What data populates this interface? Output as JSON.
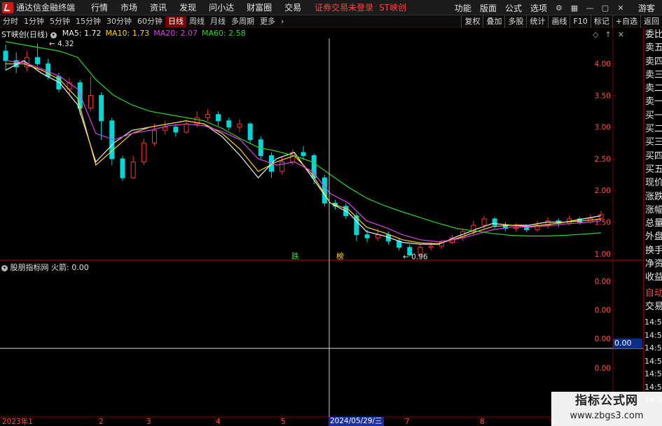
{
  "app": {
    "title": "通达信金融终端",
    "status": "证券交易未登录",
    "stock": "ST峡创"
  },
  "menu": [
    "行情",
    "市场",
    "资讯",
    "发现",
    "问小达",
    "财富圈",
    "交易"
  ],
  "right_menu": [
    "功能",
    "版面",
    "公式",
    "选项"
  ],
  "user_label": "游客",
  "periods": [
    "分时",
    "1分钟",
    "5分钟",
    "15分钟",
    "30分钟",
    "60分钟",
    "日线",
    "周线",
    "月线",
    "多周期",
    "更多"
  ],
  "active_period": "日线",
  "tools": [
    "复权",
    "叠加",
    "多股",
    "统计",
    "画线",
    "F10",
    "标记",
    "+自选",
    "返回"
  ],
  "legend": {
    "name": "ST峡创(日线)",
    "ma": [
      {
        "label": "MA5: 1.72",
        "color": "#f0f0f0"
      },
      {
        "label": "MA10: 1.73",
        "color": "#ffd21e"
      },
      {
        "label": "MA20: 2.07",
        "color": "#e040e8"
      },
      {
        "label": "MA60: 2.58",
        "color": "#27d827"
      }
    ]
  },
  "indicator": {
    "legend": "股朋指标网  火箭: 0.00",
    "value": "0.00",
    "ticks": [
      "0.00",
      "0.00",
      "0.00",
      "0.00",
      "0.00"
    ]
  },
  "side_panel": {
    "labels": [
      "委比",
      "卖五",
      "卖四",
      "卖三",
      "卖二",
      "卖一",
      "买一",
      "买二",
      "买三",
      "买四",
      "买五",
      "现价",
      "涨跌",
      "涨幅",
      "总量",
      "外盘",
      "换手",
      "净资",
      "收益"
    ],
    "lower": [
      "自动",
      "交易"
    ],
    "times": [
      "14:55",
      "14:55",
      "14:55",
      "14:56",
      "14:56",
      "14:56",
      "14:56"
    ]
  },
  "annotations": {
    "high": "4.32",
    "low": "0.96",
    "mark_down": "跌",
    "mark_flag": "榜"
  },
  "selected_date": "2024/05/29/三",
  "watermark": {
    "line1": "指标公式网",
    "line2": "www.zbgs3.com"
  },
  "colors": {
    "up": "#ff3030",
    "down": "#00d8d8",
    "ma5": "#f0f0f0",
    "ma10": "#ffd21e",
    "ma20": "#e040e8",
    "ma60": "#27d827",
    "grid": "#7a0000"
  },
  "chart_data": {
    "type": "candlestick",
    "y_ticks": [
      1.0,
      1.5,
      2.0,
      2.5,
      3.0,
      3.5,
      4.0
    ],
    "ylim": [
      0.92,
      4.4
    ],
    "x_labels": [
      "2023年1",
      "2",
      "3",
      "4",
      "5",
      "7",
      "8",
      "9"
    ],
    "ma_lines": {
      "ma5": [
        3.9,
        4.05,
        3.85,
        3.7,
        3.35,
        2.45,
        2.75,
        2.95,
        3.0,
        3.05,
        3.1,
        3.05,
        2.85,
        2.55,
        2.2,
        2.5,
        2.6,
        2.2,
        1.8,
        1.65,
        1.35,
        1.28,
        1.18,
        1.15,
        1.15,
        1.27,
        1.38,
        1.48,
        1.45,
        1.45,
        1.5,
        1.5,
        1.55,
        1.6
      ],
      "ma10": [
        4.0,
        4.0,
        3.9,
        3.75,
        3.45,
        2.4,
        2.65,
        2.9,
        3.0,
        3.05,
        3.1,
        3.05,
        2.9,
        2.65,
        2.3,
        2.45,
        2.55,
        2.25,
        1.8,
        1.7,
        1.42,
        1.33,
        1.22,
        1.17,
        1.16,
        1.24,
        1.34,
        1.43,
        1.45,
        1.43,
        1.46,
        1.5,
        1.52,
        1.55
      ],
      "ma20": [
        4.05,
        4.02,
        3.92,
        3.8,
        3.6,
        2.9,
        2.8,
        2.9,
        2.95,
        3.02,
        3.05,
        3.02,
        2.93,
        2.8,
        2.5,
        2.4,
        2.45,
        2.3,
        1.95,
        1.8,
        1.52,
        1.42,
        1.3,
        1.22,
        1.19,
        1.23,
        1.3,
        1.38,
        1.42,
        1.42,
        1.44,
        1.47,
        1.49,
        1.52
      ],
      "ma60": [
        4.35,
        4.3,
        4.25,
        4.2,
        4.1,
        3.75,
        3.5,
        3.35,
        3.25,
        3.2,
        3.15,
        3.1,
        2.98,
        2.82,
        2.68,
        2.62,
        2.55,
        2.45,
        2.25,
        2.05,
        1.88,
        1.76,
        1.66,
        1.57,
        1.48,
        1.4,
        1.36,
        1.32,
        1.29,
        1.28,
        1.28,
        1.29,
        1.31,
        1.33
      ]
    },
    "candles": [
      [
        4.2,
        4.05,
        4.3,
        3.9
      ],
      [
        4.05,
        3.95,
        4.18,
        3.85
      ],
      [
        3.95,
        4.1,
        4.2,
        3.88
      ],
      [
        4.1,
        4.0,
        4.32,
        3.96
      ],
      [
        4.0,
        3.8,
        4.08,
        3.75
      ],
      [
        3.8,
        3.6,
        3.86,
        3.55
      ],
      [
        3.6,
        3.7,
        3.78,
        3.5
      ],
      [
        3.7,
        3.3,
        3.74,
        3.2
      ],
      [
        3.3,
        3.5,
        3.8,
        3.25
      ],
      [
        3.5,
        3.1,
        3.55,
        2.8
      ],
      [
        3.1,
        2.5,
        3.15,
        2.4
      ],
      [
        2.5,
        2.2,
        2.55,
        2.15
      ],
      [
        2.2,
        2.45,
        2.55,
        2.18
      ],
      [
        2.45,
        2.75,
        2.82,
        2.4
      ],
      [
        2.75,
        2.95,
        3.05,
        2.7
      ],
      [
        2.95,
        3.0,
        3.1,
        2.88
      ],
      [
        3.0,
        2.92,
        3.05,
        2.85
      ],
      [
        2.92,
        3.05,
        3.12,
        2.9
      ],
      [
        3.05,
        3.15,
        3.25,
        3.0
      ],
      [
        3.15,
        3.2,
        3.28,
        3.1
      ],
      [
        3.2,
        3.1,
        3.25,
        3.02
      ],
      [
        3.1,
        3.0,
        3.15,
        2.95
      ],
      [
        3.0,
        3.05,
        3.12,
        2.92
      ],
      [
        3.05,
        2.8,
        3.08,
        2.75
      ],
      [
        2.8,
        2.55,
        2.85,
        2.5
      ],
      [
        2.55,
        2.3,
        2.6,
        2.2
      ],
      [
        2.3,
        2.45,
        2.52,
        2.25
      ],
      [
        2.45,
        2.6,
        2.65,
        2.4
      ],
      [
        2.6,
        2.55,
        2.7,
        2.48
      ],
      [
        2.55,
        2.2,
        2.58,
        2.1
      ],
      [
        2.2,
        1.8,
        2.25,
        1.75
      ],
      [
        1.8,
        1.75,
        1.85,
        1.7
      ],
      [
        1.75,
        1.6,
        1.8,
        1.55
      ],
      [
        1.6,
        1.3,
        1.65,
        1.2
      ],
      [
        1.3,
        1.25,
        1.38,
        1.18
      ],
      [
        1.25,
        1.3,
        1.4,
        1.2
      ],
      [
        1.3,
        1.2,
        1.35,
        1.15
      ],
      [
        1.2,
        1.1,
        1.25,
        1.05
      ],
      [
        1.1,
        0.98,
        1.15,
        0.96
      ],
      [
        0.98,
        1.1,
        1.15,
        0.96
      ],
      [
        1.1,
        1.12,
        1.18,
        1.05
      ],
      [
        1.12,
        1.18,
        1.22,
        1.08
      ],
      [
        1.18,
        1.25,
        1.3,
        1.15
      ],
      [
        1.25,
        1.35,
        1.4,
        1.2
      ],
      [
        1.35,
        1.45,
        1.52,
        1.3
      ],
      [
        1.45,
        1.55,
        1.6,
        1.4
      ],
      [
        1.55,
        1.45,
        1.58,
        1.4
      ],
      [
        1.45,
        1.4,
        1.5,
        1.35
      ],
      [
        1.4,
        1.42,
        1.48,
        1.35
      ],
      [
        1.42,
        1.38,
        1.46,
        1.34
      ],
      [
        1.38,
        1.45,
        1.52,
        1.35
      ],
      [
        1.45,
        1.52,
        1.58,
        1.4
      ],
      [
        1.52,
        1.48,
        1.56,
        1.42
      ],
      [
        1.48,
        1.55,
        1.6,
        1.45
      ],
      [
        1.55,
        1.5,
        1.58,
        1.46
      ],
      [
        1.5,
        1.56,
        1.62,
        1.47
      ],
      [
        1.56,
        1.62,
        1.68,
        1.52
      ]
    ]
  }
}
